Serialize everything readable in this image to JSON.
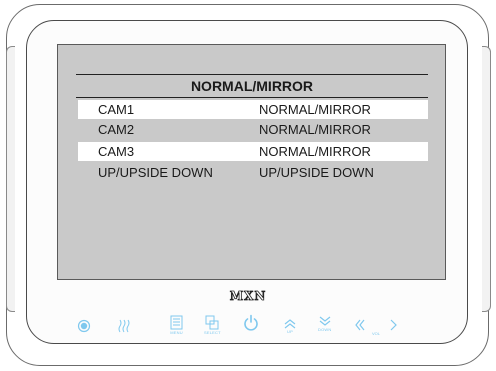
{
  "osd": {
    "title": "NORMAL/MIRROR",
    "rows": [
      {
        "label": "CAM1",
        "value": "NORMAL/MIRROR",
        "highlighted": true
      },
      {
        "label": "CAM2",
        "value": "NORMAL/MIRROR",
        "highlighted": false
      },
      {
        "label": "CAM3",
        "value": "NORMAL/MIRROR",
        "highlighted": true
      },
      {
        "label": "UP/UPSIDE DOWN",
        "value": "UP/UPSIDE DOWN",
        "highlighted": false
      }
    ]
  },
  "brand": "MXN",
  "buttons": {
    "power_mode": {
      "icon": "target-icon"
    },
    "heat": {
      "icon": "heat-waves-icon"
    },
    "menu": {
      "icon": "menu-icon",
      "label": "MENU"
    },
    "select": {
      "icon": "select-icon",
      "label": "SELECT"
    },
    "power": {
      "icon": "power-icon"
    },
    "up": {
      "icon": "chevron-up-icon",
      "label": "UP"
    },
    "down": {
      "icon": "chevron-down-icon",
      "label": "DOWN"
    },
    "vol_down": {
      "icon": "chevron-left-double-icon"
    },
    "vol_label": "VOL",
    "vol_up": {
      "icon": "chevron-right-icon"
    }
  },
  "colors": {
    "button_accent": "#7fc8ee",
    "screen_bg": "#c9c9c9",
    "highlight": "#ffffff"
  }
}
